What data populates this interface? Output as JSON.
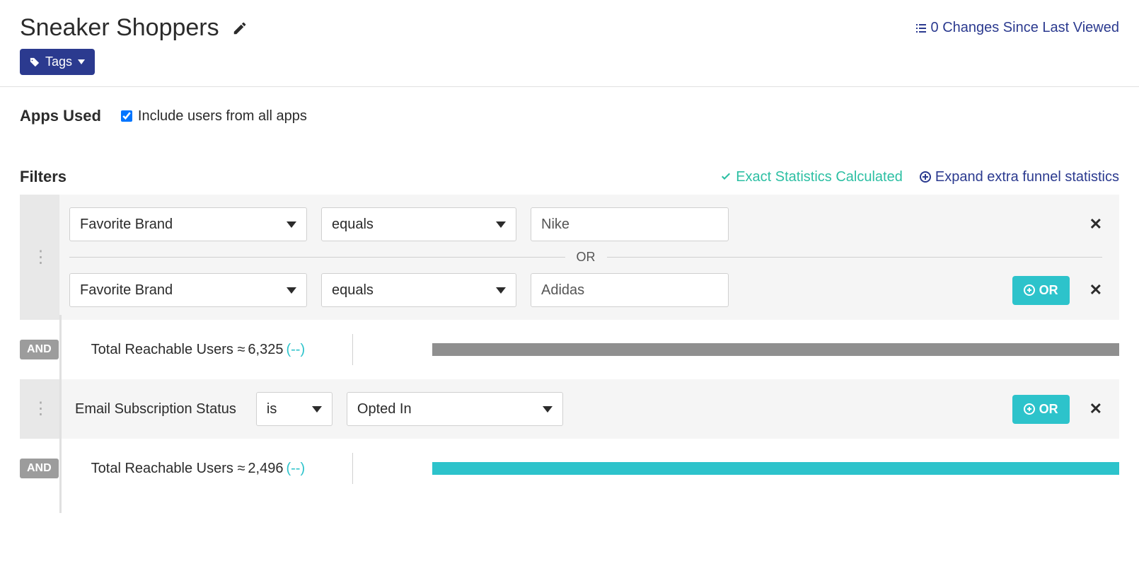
{
  "header": {
    "title": "Sneaker Shoppers",
    "changes_text": "0 Changes Since Last Viewed",
    "tags_label": "Tags"
  },
  "apps": {
    "section_label": "Apps Used",
    "checkbox_label": "Include users from all apps"
  },
  "filters_header": {
    "label": "Filters",
    "stat_calc": "Exact Statistics Calculated",
    "expand": "Expand extra funnel statistics"
  },
  "group1": {
    "rows": [
      {
        "attr": "Favorite Brand",
        "op": "equals",
        "val": "Nike"
      },
      {
        "attr": "Favorite Brand",
        "op": "equals",
        "val": "Adidas"
      }
    ],
    "or_label": "OR",
    "or_btn": "OR"
  },
  "stat1": {
    "and_label": "AND",
    "label": "Total Reachable Users ≈ ",
    "value": "6,325",
    "dashes": "(--)"
  },
  "group2": {
    "attr_label": "Email Subscription Status",
    "op": "is",
    "val": "Opted In",
    "or_btn": "OR"
  },
  "stat2": {
    "and_label": "AND",
    "label": "Total Reachable Users ≈ ",
    "value": "2,496",
    "dashes": "(--)"
  }
}
